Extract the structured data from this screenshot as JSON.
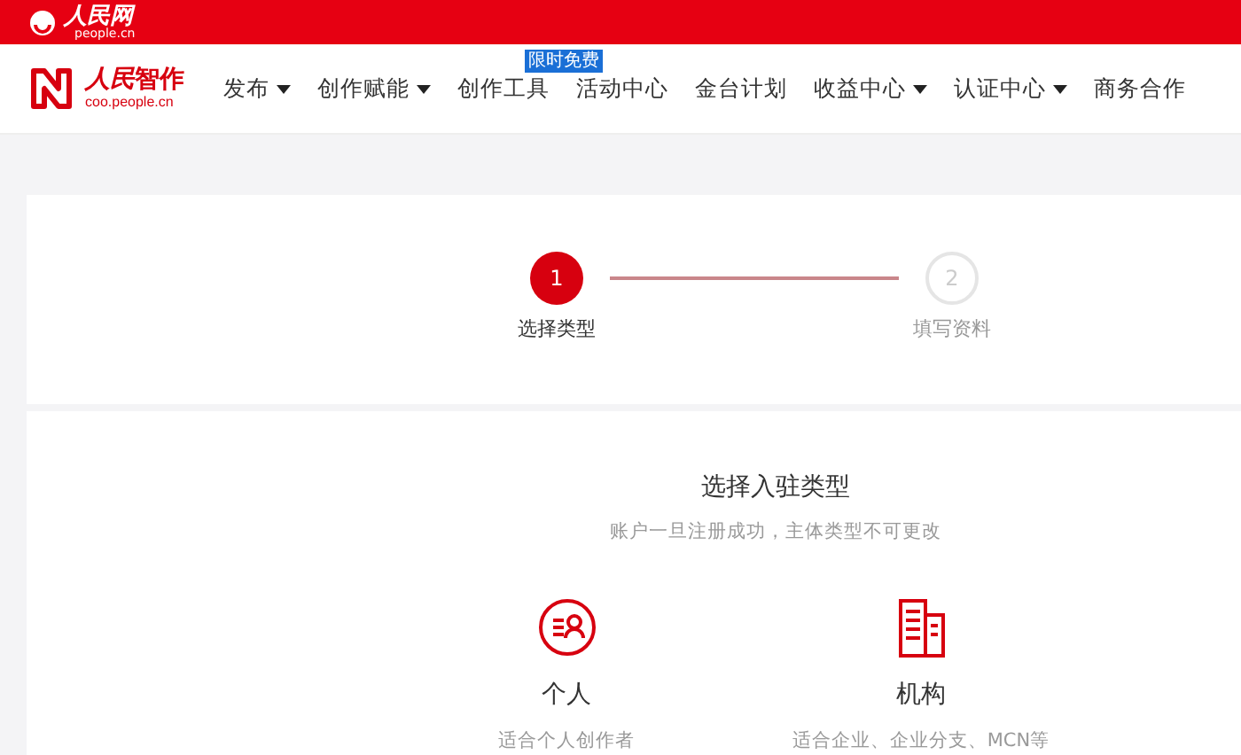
{
  "top_bar": {
    "logo_text": "人民网",
    "logo_sub": "people.cn"
  },
  "nav": {
    "brand": {
      "name_a": "人民",
      "name_b": "智作",
      "domain": "coo.people.cn"
    },
    "items": [
      {
        "label": "发布",
        "dropdown": true
      },
      {
        "label": "创作赋能",
        "dropdown": true
      },
      {
        "label": "创作工具",
        "dropdown": false,
        "badge": "限时免费"
      },
      {
        "label": "活动中心",
        "dropdown": false
      },
      {
        "label": "金台计划",
        "dropdown": false
      },
      {
        "label": "收益中心",
        "dropdown": true
      },
      {
        "label": "认证中心",
        "dropdown": true
      },
      {
        "label": "商务合作",
        "dropdown": false
      }
    ]
  },
  "steps": [
    {
      "number": "1",
      "label": "选择类型",
      "selected": true
    },
    {
      "number": "2",
      "label": "填写资料",
      "selected": false
    }
  ],
  "type_section": {
    "title": "选择入驻类型",
    "subtitle": "账户一旦注册成功，主体类型不可更改",
    "options": [
      {
        "kind": "person",
        "name": "个人",
        "description": "适合个人创作者"
      },
      {
        "kind": "organization",
        "name": "机构",
        "description": "适合企业、企业分支、MCN等"
      }
    ]
  }
}
